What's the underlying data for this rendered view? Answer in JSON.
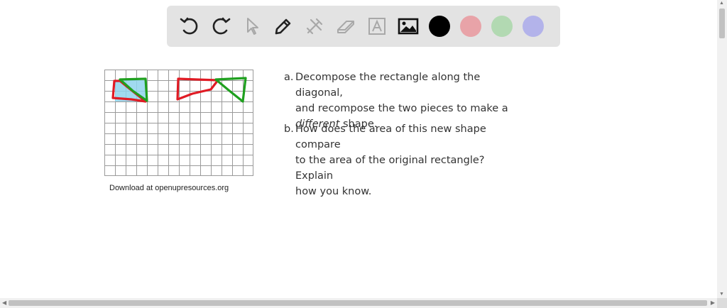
{
  "toolbar": {
    "tools": [
      {
        "name": "undo-icon",
        "enabled": true
      },
      {
        "name": "redo-icon",
        "enabled": true
      },
      {
        "name": "select-arrow-icon",
        "enabled": false
      },
      {
        "name": "pen-icon",
        "enabled": true
      },
      {
        "name": "tools-icon",
        "enabled": false
      },
      {
        "name": "eraser-icon",
        "enabled": false
      },
      {
        "name": "text-icon",
        "enabled": false
      },
      {
        "name": "image-icon",
        "enabled": true
      }
    ],
    "colors": [
      "#000000",
      "#e8a3a8",
      "#b2d9b2",
      "#b3b3ea"
    ]
  },
  "worksheet": {
    "caption": "Download at openupresources.org",
    "question_a": {
      "letter": "a.",
      "line1": "Decompose the rectangle along the diagonal,",
      "line2": "and recompose the two pieces to make a",
      "line3_emph": "different",
      "line3_rest": " shape."
    },
    "question_b": {
      "letter": "b.",
      "line1": "How does the area of this new shape compare",
      "line2": "to the area of the original rectangle? Explain",
      "line3": "how you know."
    }
  },
  "annotation_colors": {
    "red": "#e01b24",
    "green": "#1fa01f",
    "fill": "#8fd3ec"
  },
  "scrollbars": {
    "up": "▲",
    "down": "▼",
    "left": "◀",
    "right": "▶"
  }
}
